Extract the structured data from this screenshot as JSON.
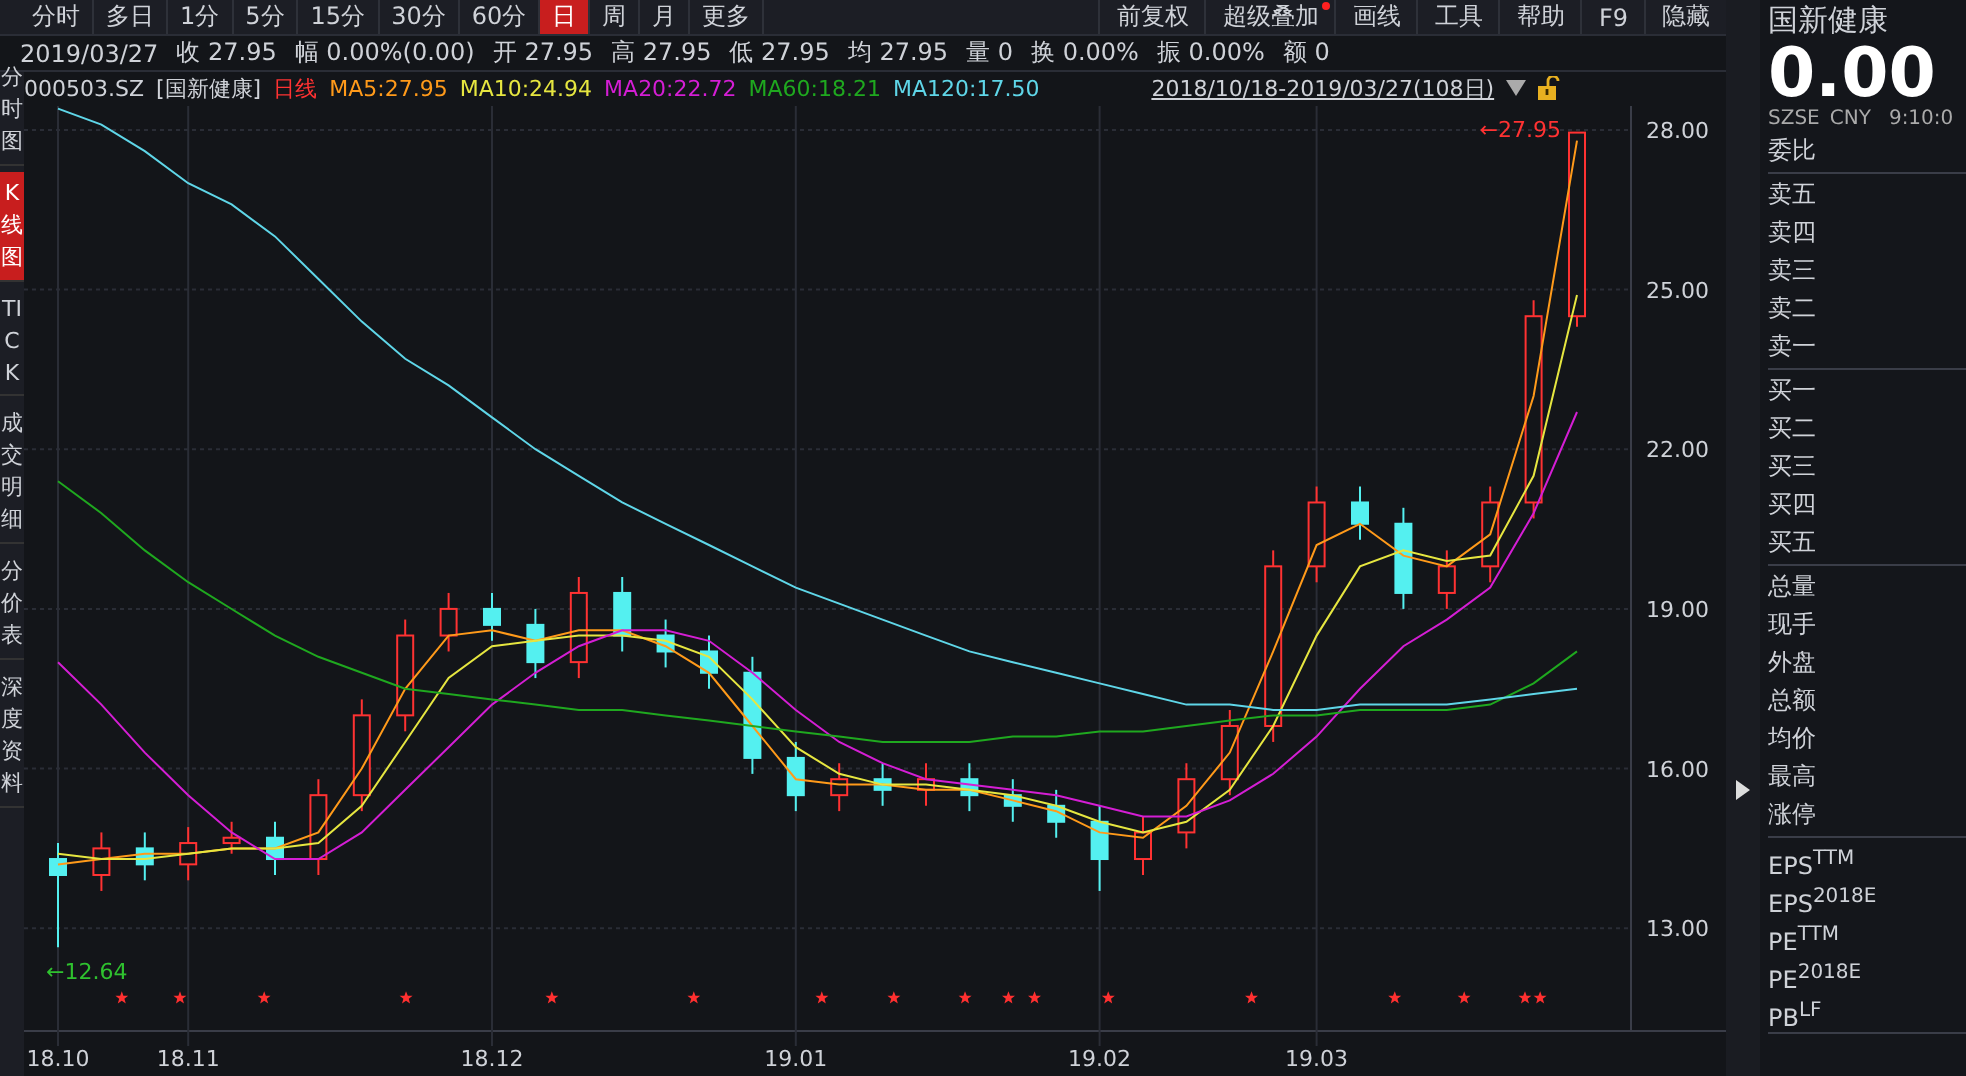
{
  "toolbar": {
    "tabs": [
      {
        "label": "分时",
        "selected": false
      },
      {
        "label": "多日",
        "selected": false
      },
      {
        "label": "1分",
        "selected": false
      },
      {
        "label": "5分",
        "selected": false
      },
      {
        "label": "15分",
        "selected": false
      },
      {
        "label": "30分",
        "selected": false
      },
      {
        "label": "60分",
        "selected": false
      },
      {
        "label": "日",
        "selected": true
      },
      {
        "label": "周",
        "selected": false
      },
      {
        "label": "月",
        "selected": false
      },
      {
        "label": "更多",
        "selected": false
      }
    ],
    "tools": [
      {
        "label": "前复权",
        "notification": false
      },
      {
        "label": "超级叠加",
        "notification": true
      },
      {
        "label": "画线",
        "notification": false
      },
      {
        "label": "工具",
        "notification": false
      },
      {
        "label": "帮助",
        "notification": false
      },
      {
        "label": "F9",
        "notification": false
      },
      {
        "label": "隐藏",
        "notification": false
      }
    ]
  },
  "quote_bar": {
    "date": "2019/03/27",
    "items": [
      {
        "label": "收",
        "value": "27.95"
      },
      {
        "label": "幅",
        "value": "0.00%(0.00)"
      },
      {
        "label": "开",
        "value": "27.95"
      },
      {
        "label": "高",
        "value": "27.95"
      },
      {
        "label": "低",
        "value": "27.95"
      },
      {
        "label": "均",
        "value": "27.95"
      },
      {
        "label": "量",
        "value": "0"
      },
      {
        "label": "换",
        "value": "0.00%"
      },
      {
        "label": "振",
        "value": "0.00%"
      },
      {
        "label": "额",
        "value": "0"
      }
    ]
  },
  "side_tabs": [
    {
      "label": "分时图",
      "selected": false
    },
    {
      "label": "K线图",
      "selected": true
    },
    {
      "label": "TICK",
      "selected": false
    },
    {
      "label": "成交明细",
      "selected": false
    },
    {
      "label": "分价表",
      "selected": false
    },
    {
      "label": "深度资料",
      "selected": false
    }
  ],
  "chart": {
    "code": "000503.SZ",
    "name": "[国新健康]",
    "period": "日线",
    "legend_values": [
      ":27.95",
      ":24.94",
      ":22.72",
      ":18.21",
      ":17.50"
    ],
    "range": "2018/10/18-2019/03/27(108日)",
    "chart_data": {
      "type": "candlestick",
      "categories": [
        "18.10",
        null,
        null,
        "18.11",
        null,
        null,
        null,
        null,
        null,
        null,
        "18.12",
        null,
        null,
        null,
        null,
        null,
        null,
        "19.01",
        null,
        null,
        null,
        null,
        null,
        null,
        "19.02",
        null,
        null,
        null,
        null,
        "19.03",
        null,
        null,
        null,
        null,
        null,
        null
      ],
      "ylim": [
        11.2,
        28.45
      ],
      "grid": true,
      "yticks": [
        {
          "value": 13,
          "label": "13.00"
        },
        {
          "value": 16,
          "label": "16.00"
        },
        {
          "value": 19,
          "label": "19.00"
        },
        {
          "value": 22,
          "label": "22.00"
        },
        {
          "value": 25,
          "label": "25.00"
        },
        {
          "value": 28,
          "label": "28.00"
        }
      ],
      "ohlc": [
        [
          14.3,
          14.6,
          12.64,
          14.0
        ],
        [
          14.0,
          14.8,
          13.7,
          14.5
        ],
        [
          14.5,
          14.8,
          13.9,
          14.2
        ],
        [
          14.2,
          14.9,
          13.9,
          14.6
        ],
        [
          14.6,
          15.0,
          14.4,
          14.7
        ],
        [
          14.7,
          15.0,
          14.0,
          14.3
        ],
        [
          14.3,
          15.8,
          14.0,
          15.5
        ],
        [
          15.5,
          17.3,
          15.2,
          17.0
        ],
        [
          17.0,
          18.8,
          16.7,
          18.5
        ],
        [
          18.5,
          19.3,
          18.2,
          19.0
        ],
        [
          19.0,
          19.3,
          18.4,
          18.7
        ],
        [
          18.7,
          19.0,
          17.7,
          18.0
        ],
        [
          18.0,
          19.6,
          17.7,
          19.3
        ],
        [
          19.3,
          19.6,
          18.2,
          18.5
        ],
        [
          18.5,
          18.8,
          17.9,
          18.2
        ],
        [
          18.2,
          18.5,
          17.5,
          17.8
        ],
        [
          17.8,
          18.1,
          15.9,
          16.2
        ],
        [
          16.2,
          16.5,
          15.2,
          15.5
        ],
        [
          15.5,
          16.1,
          15.2,
          15.8
        ],
        [
          15.8,
          16.1,
          15.3,
          15.6
        ],
        [
          15.6,
          16.1,
          15.3,
          15.8
        ],
        [
          15.8,
          16.1,
          15.2,
          15.5
        ],
        [
          15.5,
          15.8,
          15.0,
          15.3
        ],
        [
          15.3,
          15.6,
          14.7,
          15.0
        ],
        [
          15.0,
          15.3,
          13.7,
          14.3
        ],
        [
          14.3,
          15.1,
          14.0,
          14.8
        ],
        [
          14.8,
          16.1,
          14.5,
          15.8
        ],
        [
          15.8,
          17.1,
          15.5,
          16.8
        ],
        [
          16.8,
          20.1,
          16.5,
          19.8
        ],
        [
          19.8,
          21.3,
          19.5,
          21.0
        ],
        [
          21.0,
          21.3,
          20.3,
          20.6
        ],
        [
          20.6,
          20.9,
          19.0,
          19.3
        ],
        [
          19.3,
          20.1,
          19.0,
          19.8
        ],
        [
          19.8,
          21.3,
          19.5,
          21.0
        ],
        [
          21.0,
          24.8,
          20.7,
          24.5
        ],
        [
          24.5,
          27.95,
          24.3,
          27.95
        ]
      ],
      "series": [
        {
          "name": "MA5",
          "type": "line",
          "color": "#ff9a1a",
          "values": [
            14.2,
            14.3,
            14.4,
            14.4,
            14.5,
            14.5,
            14.8,
            16.0,
            17.5,
            18.5,
            18.6,
            18.4,
            18.6,
            18.6,
            18.3,
            17.8,
            16.8,
            15.8,
            15.7,
            15.7,
            15.6,
            15.6,
            15.4,
            15.2,
            14.8,
            14.7,
            15.3,
            16.3,
            18.2,
            20.2,
            20.6,
            20.0,
            19.8,
            20.4,
            23.0,
            27.8
          ]
        },
        {
          "name": "MA10",
          "type": "line",
          "color": "#e6e640",
          "values": [
            14.4,
            14.3,
            14.3,
            14.4,
            14.5,
            14.5,
            14.6,
            15.3,
            16.5,
            17.7,
            18.3,
            18.4,
            18.5,
            18.5,
            18.4,
            18.1,
            17.3,
            16.4,
            15.9,
            15.7,
            15.7,
            15.6,
            15.5,
            15.3,
            15.0,
            14.8,
            15.0,
            15.6,
            16.8,
            18.5,
            19.8,
            20.1,
            19.9,
            20.0,
            21.5,
            24.9
          ]
        },
        {
          "name": "MA20",
          "type": "line",
          "color": "#d41ed4",
          "values": [
            18.0,
            17.2,
            16.3,
            15.5,
            14.8,
            14.3,
            14.3,
            14.8,
            15.6,
            16.4,
            17.2,
            17.8,
            18.3,
            18.6,
            18.6,
            18.4,
            17.8,
            17.1,
            16.5,
            16.1,
            15.8,
            15.7,
            15.6,
            15.5,
            15.3,
            15.1,
            15.1,
            15.4,
            15.9,
            16.6,
            17.5,
            18.3,
            18.8,
            19.4,
            20.8,
            22.7
          ]
        },
        {
          "name": "MA60",
          "type": "line",
          "color": "#1fa81f",
          "values": [
            21.4,
            20.8,
            20.1,
            19.5,
            19.0,
            18.5,
            18.1,
            17.8,
            17.5,
            17.4,
            17.3,
            17.2,
            17.1,
            17.1,
            17.0,
            16.9,
            16.8,
            16.7,
            16.6,
            16.5,
            16.5,
            16.5,
            16.6,
            16.6,
            16.7,
            16.7,
            16.8,
            16.9,
            17.0,
            17.0,
            17.1,
            17.1,
            17.1,
            17.2,
            17.6,
            18.2
          ]
        },
        {
          "name": "MA120",
          "type": "line",
          "color": "#5fd6e8",
          "values": [
            28.4,
            28.1,
            27.6,
            27.0,
            26.6,
            26.0,
            25.2,
            24.4,
            23.7,
            23.2,
            22.6,
            22.0,
            21.5,
            21.0,
            20.6,
            20.2,
            19.8,
            19.4,
            19.1,
            18.8,
            18.5,
            18.2,
            18.0,
            17.8,
            17.6,
            17.4,
            17.2,
            17.2,
            17.1,
            17.1,
            17.2,
            17.2,
            17.2,
            17.3,
            17.4,
            17.5
          ]
        }
      ],
      "annotations": [
        "←12.64",
        "←27.95"
      ]
    }
  },
  "quote_panel": {
    "name": "国新健康",
    "price": "0.00",
    "exchange": "SZSE",
    "currency": "CNY",
    "time": "9:10:0",
    "groups": [
      [
        "委比"
      ],
      [
        "卖五",
        "卖四",
        "卖三",
        "卖二",
        "卖一"
      ],
      [
        "买一",
        "买二",
        "买三",
        "买四",
        "买五"
      ],
      [
        "总量",
        "现手",
        "外盘",
        "总额",
        "均价",
        "最高",
        "涨停"
      ],
      [
        "EPS$^{TTM}$",
        "EPS$^{2018E}$",
        "PE$^{TTM}$",
        "PE$^{2018E}$",
        "PB$^{LF}$"
      ]
    ]
  }
}
